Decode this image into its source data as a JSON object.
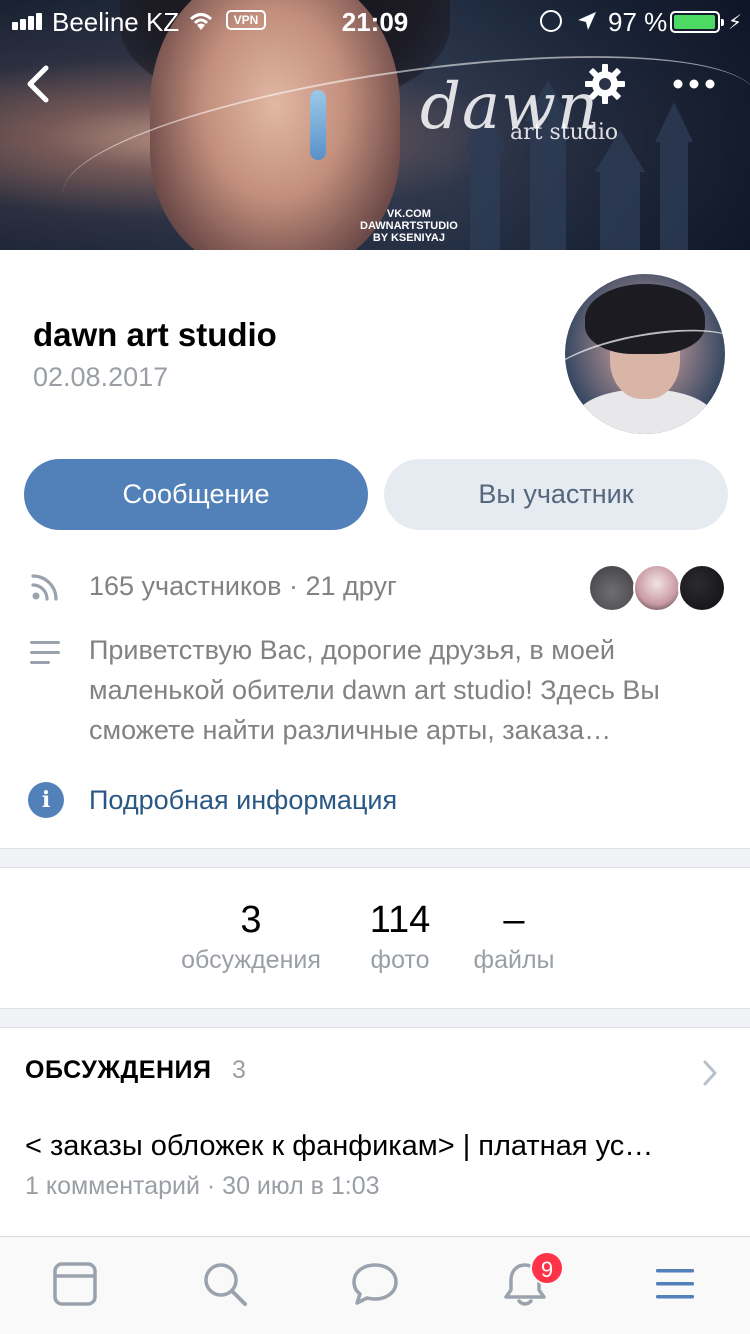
{
  "status_bar": {
    "carrier": "Beeline KZ",
    "vpn": "VPN",
    "time": "21:09",
    "battery_percent": "97 %",
    "battery_level": 0.97,
    "icons": [
      "signal-icon",
      "wifi-icon",
      "rotation-lock-icon",
      "location-icon",
      "battery-icon",
      "charging-bolt-icon"
    ]
  },
  "cover": {
    "brand": "dawn",
    "brand_sub": "art studio",
    "credit_line1": "VK.COM",
    "credit_line2": "DAWNARTSTUDIO",
    "credit_line3": "BY KSENIYAJ"
  },
  "nav": {
    "icons": [
      "back-chevron-icon",
      "gear-icon",
      "more-dots-icon"
    ]
  },
  "header": {
    "name": "dawn art studio",
    "date": "02.08.2017"
  },
  "buttons": {
    "message": "Сообщение",
    "member": "Вы участник"
  },
  "info": {
    "members": "165 участников · 21 друг",
    "description": "Приветствую Вас, дорогие друзья, в моей маленькой обители dawn art studio! Здесь Вы сможете найти различные арты, заказа…",
    "more_link": "Подробная информация",
    "info_badge": "i"
  },
  "counters": [
    {
      "value": "3",
      "label": "обсуждения"
    },
    {
      "value": "114",
      "label": "фото"
    },
    {
      "value": "–",
      "label": "файлы"
    }
  ],
  "discussions": {
    "title": "ОБСУЖДЕНИЯ",
    "count": "3",
    "topic": {
      "title": "< заказы обложек к фанфикам> | платная ус…",
      "meta": "1 комментарий · 30 июл в 1:03"
    }
  },
  "tabbar": {
    "items": [
      "news-tab",
      "search-tab",
      "messages-tab",
      "notifications-tab",
      "menu-tab"
    ],
    "notification_badge": "9"
  },
  "colors": {
    "accent": "#5181b8",
    "secondary_button": "#e5ebf1",
    "link": "#2a5885",
    "badge": "#ff3347"
  }
}
